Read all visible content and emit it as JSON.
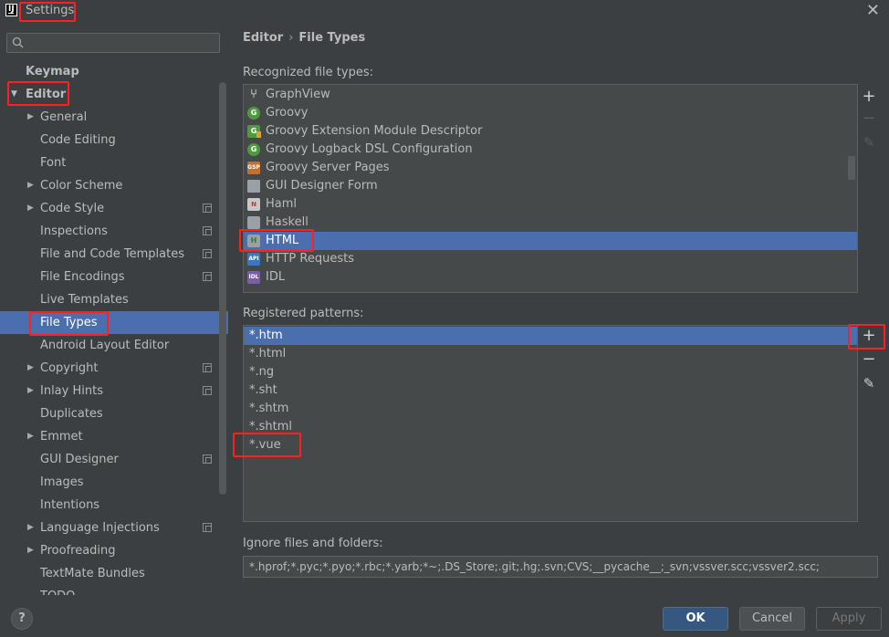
{
  "window": {
    "title": "Settings"
  },
  "search": {
    "placeholder": ""
  },
  "sidebar": {
    "items": [
      {
        "label": "Keymap",
        "level": 0,
        "arrow": "",
        "bold": true,
        "project": false,
        "selected": false
      },
      {
        "label": "Editor",
        "level": 0,
        "arrow": "▼",
        "bold": true,
        "project": false,
        "selected": false
      },
      {
        "label": "General",
        "level": 1,
        "arrow": "▶",
        "bold": false,
        "project": false,
        "selected": false
      },
      {
        "label": "Code Editing",
        "level": 1,
        "arrow": "",
        "bold": false,
        "project": false,
        "selected": false
      },
      {
        "label": "Font",
        "level": 1,
        "arrow": "",
        "bold": false,
        "project": false,
        "selected": false
      },
      {
        "label": "Color Scheme",
        "level": 1,
        "arrow": "▶",
        "bold": false,
        "project": false,
        "selected": false
      },
      {
        "label": "Code Style",
        "level": 1,
        "arrow": "▶",
        "bold": false,
        "project": true,
        "selected": false
      },
      {
        "label": "Inspections",
        "level": 1,
        "arrow": "",
        "bold": false,
        "project": true,
        "selected": false
      },
      {
        "label": "File and Code Templates",
        "level": 1,
        "arrow": "",
        "bold": false,
        "project": true,
        "selected": false
      },
      {
        "label": "File Encodings",
        "level": 1,
        "arrow": "",
        "bold": false,
        "project": true,
        "selected": false
      },
      {
        "label": "Live Templates",
        "level": 1,
        "arrow": "",
        "bold": false,
        "project": false,
        "selected": false
      },
      {
        "label": "File Types",
        "level": 1,
        "arrow": "",
        "bold": false,
        "project": false,
        "selected": true
      },
      {
        "label": "Android Layout Editor",
        "level": 1,
        "arrow": "",
        "bold": false,
        "project": false,
        "selected": false
      },
      {
        "label": "Copyright",
        "level": 1,
        "arrow": "▶",
        "bold": false,
        "project": true,
        "selected": false
      },
      {
        "label": "Inlay Hints",
        "level": 1,
        "arrow": "▶",
        "bold": false,
        "project": true,
        "selected": false
      },
      {
        "label": "Duplicates",
        "level": 1,
        "arrow": "",
        "bold": false,
        "project": false,
        "selected": false
      },
      {
        "label": "Emmet",
        "level": 1,
        "arrow": "▶",
        "bold": false,
        "project": false,
        "selected": false
      },
      {
        "label": "GUI Designer",
        "level": 1,
        "arrow": "",
        "bold": false,
        "project": true,
        "selected": false
      },
      {
        "label": "Images",
        "level": 1,
        "arrow": "",
        "bold": false,
        "project": false,
        "selected": false
      },
      {
        "label": "Intentions",
        "level": 1,
        "arrow": "",
        "bold": false,
        "project": false,
        "selected": false
      },
      {
        "label": "Language Injections",
        "level": 1,
        "arrow": "▶",
        "bold": false,
        "project": true,
        "selected": false
      },
      {
        "label": "Proofreading",
        "level": 1,
        "arrow": "▶",
        "bold": false,
        "project": false,
        "selected": false
      },
      {
        "label": "TextMate Bundles",
        "level": 1,
        "arrow": "",
        "bold": false,
        "project": false,
        "selected": false
      },
      {
        "label": "TODO",
        "level": 1,
        "arrow": "",
        "bold": false,
        "project": false,
        "selected": false
      }
    ]
  },
  "breadcrumb": {
    "parent": "Editor",
    "separator": "›",
    "current": "File Types"
  },
  "recognized": {
    "label": "Recognized file types:",
    "items": [
      {
        "label": "GraphView",
        "icon": "graph",
        "icon_text": "⑂",
        "selected": false
      },
      {
        "label": "Groovy",
        "icon": "groovy",
        "icon_text": "G",
        "selected": false
      },
      {
        "label": "Groovy Extension Module Descriptor",
        "icon": "ext",
        "icon_text": "G",
        "selected": false
      },
      {
        "label": "Groovy Logback DSL Configuration",
        "icon": "groovy",
        "icon_text": "G",
        "selected": false
      },
      {
        "label": "Groovy Server Pages",
        "icon": "gsp",
        "icon_text": "GSP",
        "selected": false
      },
      {
        "label": "GUI Designer Form",
        "icon": "form",
        "icon_text": "",
        "selected": false
      },
      {
        "label": "Haml",
        "icon": "haml",
        "icon_text": "N",
        "selected": false
      },
      {
        "label": "Haskell",
        "icon": "haskell",
        "icon_text": "",
        "selected": false
      },
      {
        "label": "HTML",
        "icon": "html",
        "icon_text": "H",
        "selected": true
      },
      {
        "label": "HTTP Requests",
        "icon": "http",
        "icon_text": "API",
        "selected": false
      },
      {
        "label": "IDL",
        "icon": "idl",
        "icon_text": "IDL",
        "selected": false
      }
    ]
  },
  "patterns": {
    "label": "Registered patterns:",
    "items": [
      {
        "label": "*.htm",
        "selected": true
      },
      {
        "label": "*.html",
        "selected": false
      },
      {
        "label": "*.ng",
        "selected": false
      },
      {
        "label": "*.sht",
        "selected": false
      },
      {
        "label": "*.shtm",
        "selected": false
      },
      {
        "label": "*.shtml",
        "selected": false
      },
      {
        "label": "*.vue",
        "selected": false
      }
    ]
  },
  "toolbar": {
    "add": "+",
    "remove": "−",
    "edit": "✎"
  },
  "ignore": {
    "label": "Ignore files and folders:",
    "value": "*.hprof;*.pyc;*.pyo;*.rbc;*.yarb;*~;.DS_Store;.git;.hg;.svn;CVS;__pycache__;_svn;vssver.scc;vssver2.scc;"
  },
  "footer": {
    "help": "?",
    "ok": "OK",
    "cancel": "Cancel",
    "apply": "Apply"
  },
  "colors": {
    "accent": "#4b6eaf",
    "highlight": "#ff1f1f",
    "background": "#3c3f41"
  }
}
